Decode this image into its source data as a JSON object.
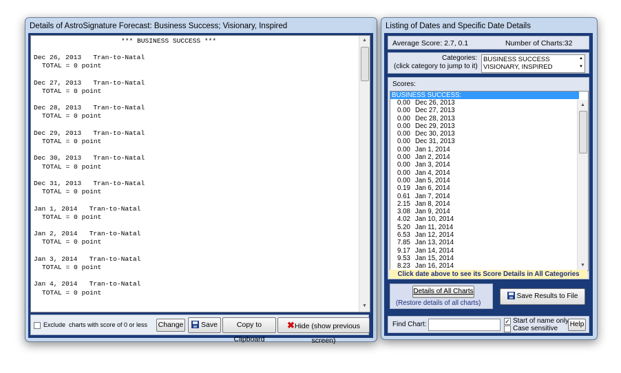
{
  "left_window": {
    "title": "Details of AstroSignature Forecast: Business Success; Visionary, Inspired",
    "header_line": "*** BUSINESS SUCCESS ***",
    "entries": [
      {
        "date_line": "Dec 26, 2013   Tran-to-Natal",
        "total": "TOTAL = 0 point"
      },
      {
        "date_line": "Dec 27, 2013   Tran-to-Natal",
        "total": "TOTAL = 0 point"
      },
      {
        "date_line": "Dec 28, 2013   Tran-to-Natal",
        "total": "TOTAL = 0 point"
      },
      {
        "date_line": "Dec 29, 2013   Tran-to-Natal",
        "total": "TOTAL = 0 point"
      },
      {
        "date_line": "Dec 30, 2013   Tran-to-Natal",
        "total": "TOTAL = 0 point"
      },
      {
        "date_line": "Dec 31, 2013   Tran-to-Natal",
        "total": "TOTAL = 0 point"
      },
      {
        "date_line": "Jan 1, 2014   Tran-to-Natal",
        "total": "TOTAL = 0 point"
      },
      {
        "date_line": "Jan 2, 2014   Tran-to-Natal",
        "total": "TOTAL = 0 point"
      },
      {
        "date_line": "Jan 3, 2014   Tran-to-Natal",
        "total": "TOTAL = 0 point"
      },
      {
        "date_line": "Jan 4, 2014   Tran-to-Natal",
        "total": "TOTAL = 0 point"
      }
    ],
    "exclude_label": "Exclude  charts with score of 0 or less",
    "change_button": "Change",
    "save_button": "Save",
    "copy_button": "Copy to Clipboard",
    "hide_button": "Hide (show previous screen)"
  },
  "right_window": {
    "title": "Listing of Dates and Specific Date Details",
    "average_score": "Average Score: 2.7, 0.1",
    "number_of_charts": "Number of Charts:32",
    "categories_label_1": "Categories:",
    "categories_label_2": "(click category to jump to it)",
    "categories": [
      "BUSINESS SUCCESS",
      "VISIONARY, INSPIRED"
    ],
    "scores_label": "Scores:",
    "scores_header": "BUSINESS SUCCESS:",
    "scores": [
      {
        "score": "0.00",
        "date": "Dec 26, 2013"
      },
      {
        "score": "0.00",
        "date": "Dec 27, 2013"
      },
      {
        "score": "0.00",
        "date": "Dec 28, 2013"
      },
      {
        "score": "0.00",
        "date": "Dec 29, 2013"
      },
      {
        "score": "0.00",
        "date": "Dec 30, 2013"
      },
      {
        "score": "0.00",
        "date": "Dec 31, 2013"
      },
      {
        "score": "0.00",
        "date": "Jan 1, 2014"
      },
      {
        "score": "0.00",
        "date": "Jan 2, 2014"
      },
      {
        "score": "0.00",
        "date": "Jan 3, 2014"
      },
      {
        "score": "0.00",
        "date": "Jan 4, 2014"
      },
      {
        "score": "0.00",
        "date": "Jan 5, 2014"
      },
      {
        "score": "0.19",
        "date": "Jan 6, 2014"
      },
      {
        "score": "0.61",
        "date": "Jan 7, 2014"
      },
      {
        "score": "2.15",
        "date": "Jan 8, 2014"
      },
      {
        "score": "3.08",
        "date": "Jan 9, 2014"
      },
      {
        "score": "4.02",
        "date": "Jan 10, 2014"
      },
      {
        "score": "5.20",
        "date": "Jan 11, 2014"
      },
      {
        "score": "6.53",
        "date": "Jan 12, 2014"
      },
      {
        "score": "7.85",
        "date": "Jan 13, 2014"
      },
      {
        "score": "9.17",
        "date": "Jan 14, 2014"
      },
      {
        "score": "9.53",
        "date": "Jan 15, 2014"
      },
      {
        "score": "8.23",
        "date": "Jan 16, 2014"
      }
    ],
    "click_hint": "Click date above to see its Score Details in All Categories",
    "details_all_button": "Details of All Charts",
    "details_all_sub": "(Restore details of all charts)",
    "save_results_button": "Save Results to File",
    "find_chart_label": "Find Chart:",
    "find_chart_value": "",
    "start_of_name_label": "Start of name only",
    "start_of_name_checked": true,
    "case_sensitive_label": "Case sensitive",
    "case_sensitive_checked": false,
    "help_button": "Help"
  }
}
